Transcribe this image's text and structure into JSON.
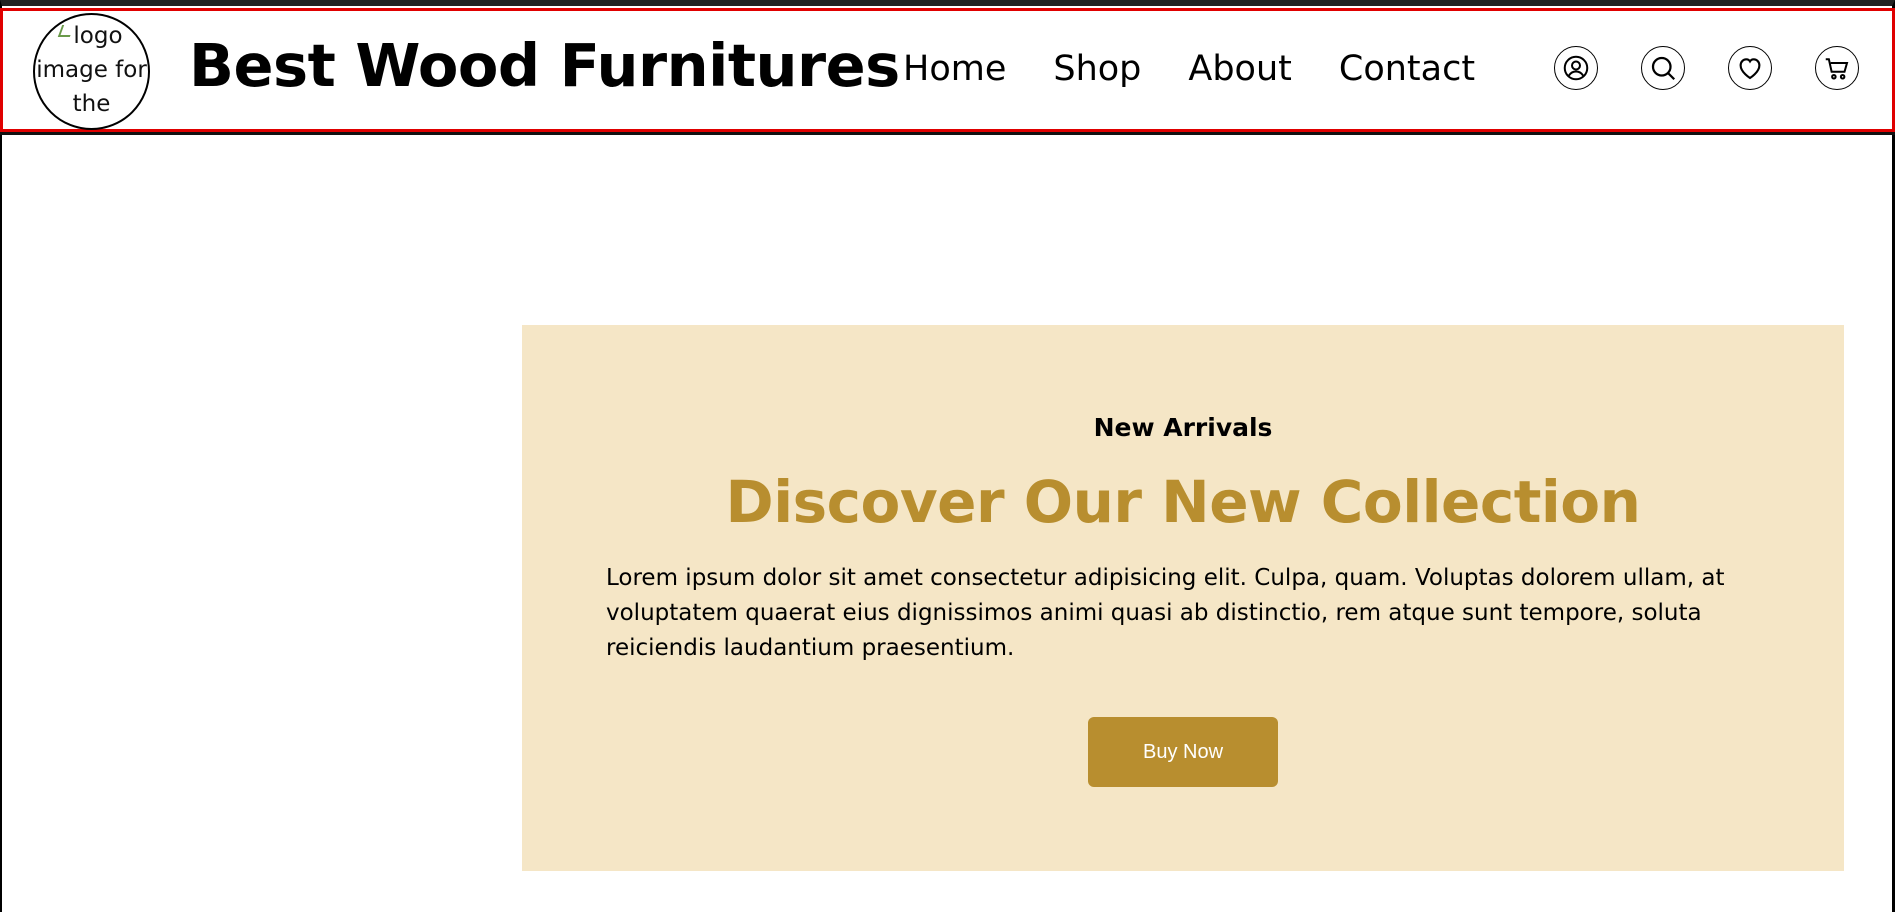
{
  "header": {
    "logo_alt": "logo image for the",
    "brand": "Best Wood Furnitures",
    "nav": [
      "Home",
      "Shop",
      "About",
      "Contact"
    ],
    "icons": [
      "user-icon",
      "search-icon",
      "heart-icon",
      "cart-icon"
    ]
  },
  "hero": {
    "eyebrow": "New Arrivals",
    "headline": "Discover Our New Collection",
    "body": "Lorem ipsum dolor sit amet consectetur adipisicing elit. Culpa, quam. Voluptas dolorem ullam, at voluptatem quaerat eius dignissimos animi quasi ab distinctio, rem atque sunt tempore, soluta reiciendis laudantium praesentium.",
    "button_label": "Buy Now"
  },
  "colors": {
    "accent": "#b88e2f",
    "hero_background": "#f5e6c6",
    "header_outline": "#e00000"
  }
}
